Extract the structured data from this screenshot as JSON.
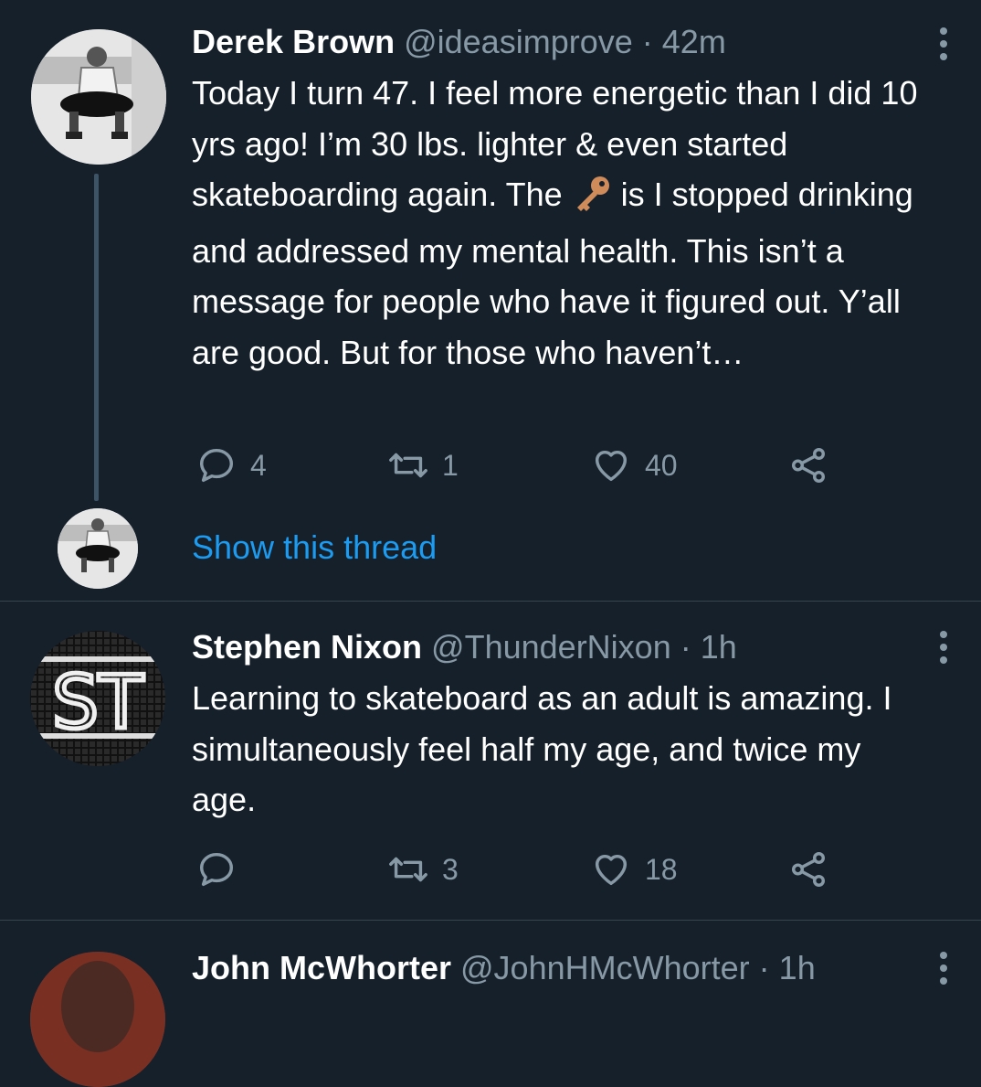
{
  "tweets": [
    {
      "name": "Derek Brown",
      "handle": "@ideasimprove",
      "dot": "·",
      "time": "42m",
      "text_before_emoji": "Today I turn 47. I feel more energetic than I did 10 yrs ago! I’m 30 lbs. lighter & even started skateboarding again. The ",
      "emoji": "key-emoji",
      "text_after_emoji": " is I stopped drinking and addressed my mental health. This isn’t a message for people who have it figured out. Y’all are good. But for those who haven’t…",
      "replies": "4",
      "retweets": "1",
      "likes": "40"
    },
    {
      "name": "Stephen Nixon",
      "handle": "@ThunderNixon",
      "dot": "·",
      "time": "1h",
      "text": "Learning to skateboard as an adult is amazing. I simultaneously feel half my age, and twice my age.",
      "replies": "",
      "retweets": "3",
      "likes": "18",
      "avatar_text": "ST"
    },
    {
      "name": "John McWhorter",
      "handle": "@JohnHMcWhorter",
      "dot": "·",
      "time": "1h"
    }
  ],
  "show_thread": "Show this thread",
  "colors": {
    "background": "#15202b",
    "secondary_text": "#8899a6",
    "link": "#1d9bf0",
    "divider": "#38444d"
  }
}
